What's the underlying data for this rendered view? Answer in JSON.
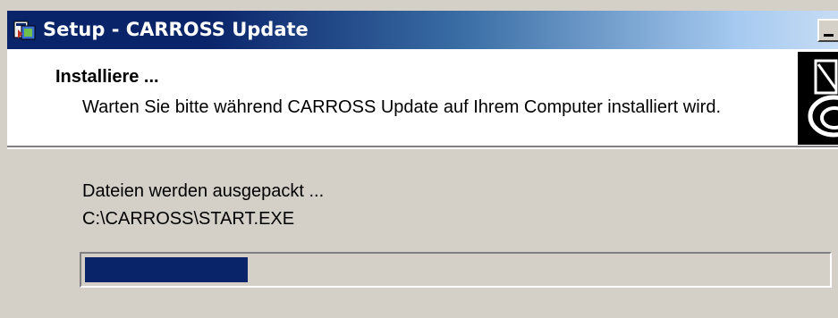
{
  "window": {
    "title": "Setup - CARROSS Update",
    "icon": "setup-installer-icon",
    "minimize_icon": "minimize-icon"
  },
  "header": {
    "title": "Installiere ...",
    "subtitle": "Warten Sie bitte während CARROSS Update auf Ihrem Computer installiert wird.",
    "logo": "carross-logo"
  },
  "body": {
    "status_text": "Dateien werden ausgepackt ...",
    "current_file": "C:\\CARROSS\\START.EXE",
    "progress": 0.22
  },
  "colors": {
    "title_bar_start": "#0a246a",
    "title_bar_end": "#a6caf0",
    "progress_fill": "#0a246a",
    "dialog_background": "#d4d0c8",
    "header_background": "#ffffff"
  }
}
